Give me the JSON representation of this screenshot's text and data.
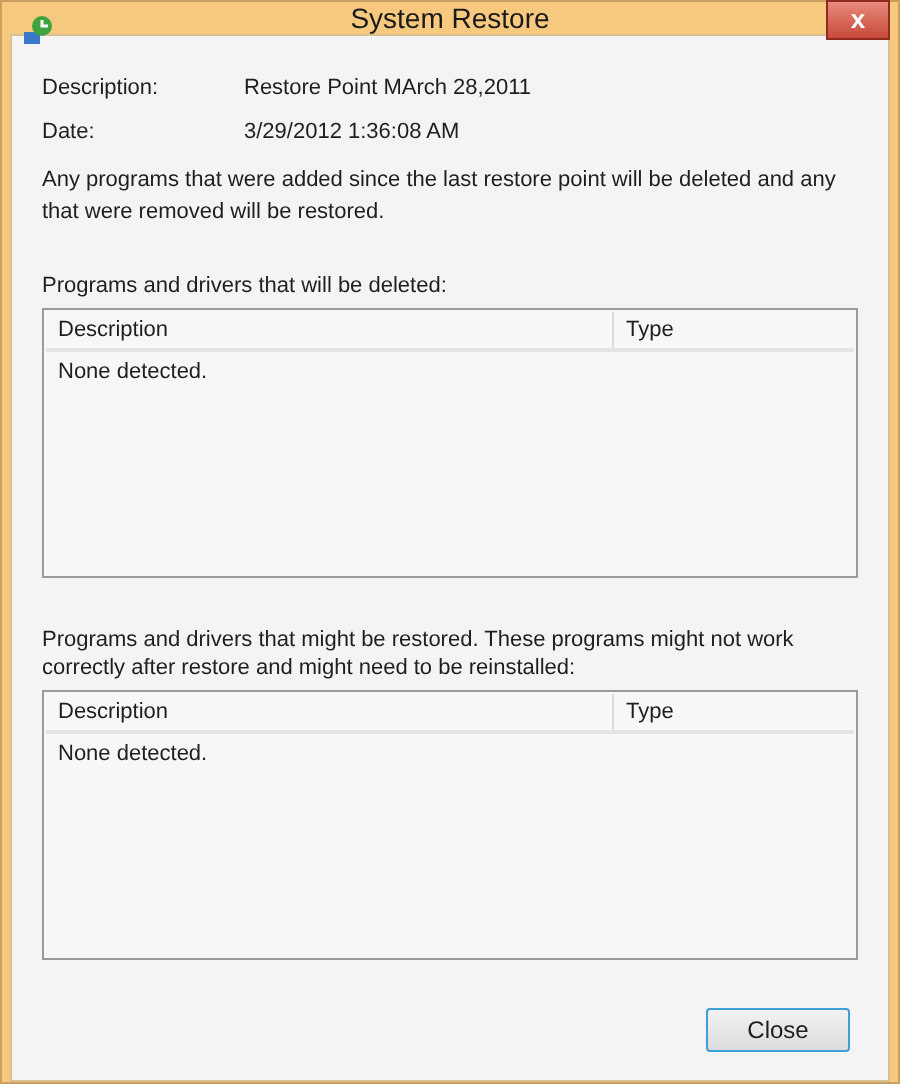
{
  "window": {
    "title": "System Restore",
    "close_symbol": "x"
  },
  "details": [
    {
      "label": "Description:",
      "value": "Restore Point MArch 28,2011"
    },
    {
      "label": "Date:",
      "value": "3/29/2012 1:36:08 AM"
    }
  ],
  "note": "Any programs that were added since the last restore point will be deleted and any that were removed will be restored.",
  "lists": [
    {
      "caption": "Programs and drivers that will be deleted:",
      "columns": [
        "Description",
        "Type"
      ],
      "empty_text": "None detected."
    },
    {
      "caption": "Programs and drivers that might be restored. These programs might not work correctly after restore and might need to be reinstalled:",
      "columns": [
        "Description",
        "Type"
      ],
      "empty_text": "None detected."
    }
  ],
  "buttons": [
    "Close"
  ]
}
